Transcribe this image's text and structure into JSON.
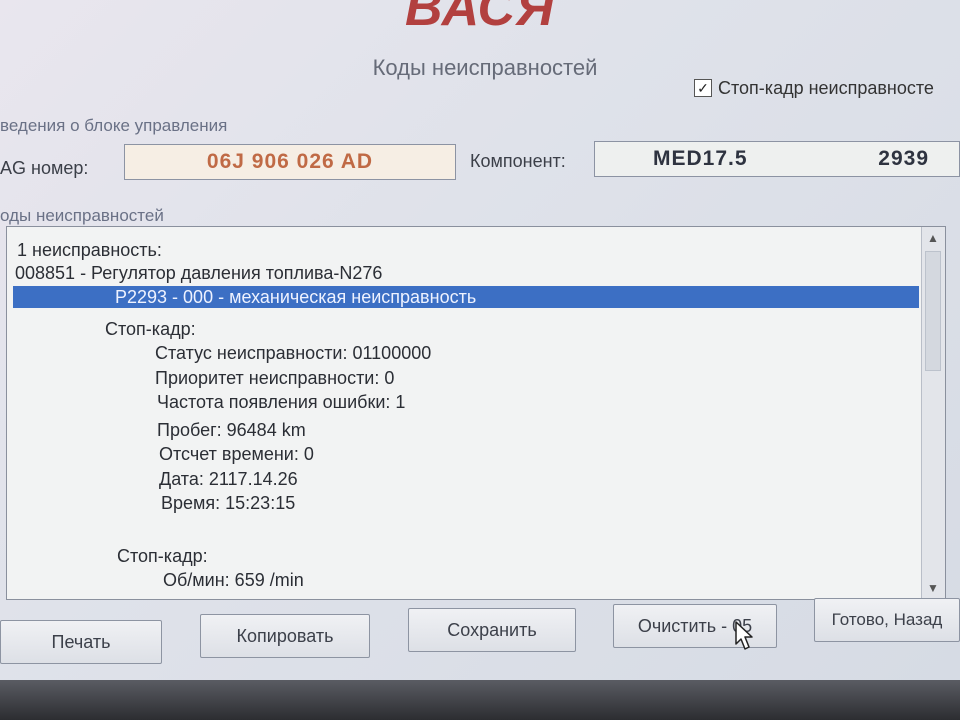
{
  "app": {
    "logo": "ВАСЯ",
    "subtitle": "Коды неисправностей"
  },
  "freeze_frame_checkbox": {
    "label": "Стоп-кадр неисправносте",
    "checked": true
  },
  "control_unit": {
    "section_label": "ведения о блоке управления",
    "vag_label": "AG номер:",
    "vag_number": "06J 906 026 AD",
    "component_label": "Компонент:",
    "component_name": "MED17.5",
    "component_code": "2939"
  },
  "faults": {
    "section_label": "оды неисправностей",
    "lines": [
      "1 неисправность:",
      "008851 - Регулятор давления топлива-N276",
      "P2293 - 000 - механическая неисправность",
      "Стоп-кадр:",
      "Статус неисправности: 01100000",
      "Приоритет неисправности: 0",
      "Частота появления ошибки: 1",
      "Пробег: 96484 km",
      "Отсчет времени: 0",
      "Дата: 2117.14.26",
      "Время: 15:23:15",
      "Стоп-кадр:",
      "Об/мин: 659 /min"
    ]
  },
  "buttons": {
    "print": "Печать",
    "copy": "Копировать",
    "save": "Сохранить",
    "clear": "Очистить - 05",
    "done": "Готово, Назад"
  },
  "colors": {
    "selection": "#3c6fc4",
    "logo": "#b2403f",
    "vag_number": "#c06a45"
  }
}
